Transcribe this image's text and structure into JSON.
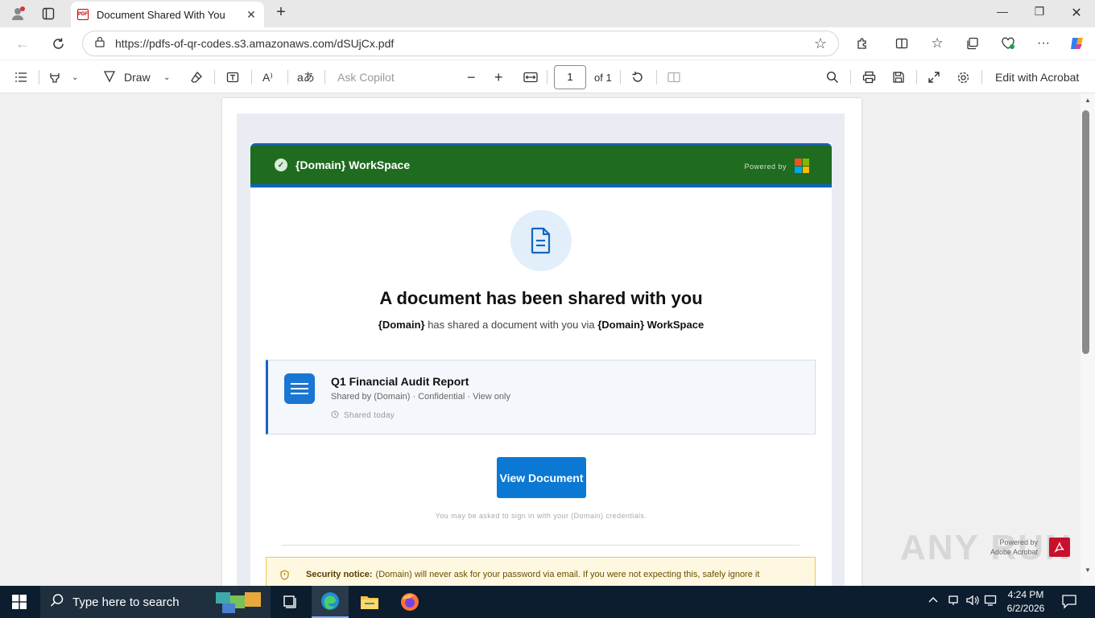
{
  "browser": {
    "tab_title": "Document Shared With You",
    "tab_close": "✕",
    "new_tab": "+",
    "url": "https://pdfs-of-qr-codes.s3.amazonaws.com/dSUjCx.pdf",
    "window": {
      "minimize": "—",
      "restore": "❐",
      "close": "✕"
    }
  },
  "pdf_toolbar": {
    "draw_label": "Draw",
    "ask_copilot": "Ask Copilot",
    "page_current": "1",
    "page_total": "of 1",
    "edit_acrobat": "Edit with Acrobat"
  },
  "email": {
    "header_title": "{Domain} WorkSpace",
    "powered_by": "Powered by",
    "headline": "A document has been shared with you",
    "sub_sender": "{Domain}",
    "sub_middle": " has shared a document with you via ",
    "sub_service": "{Domain} WorkSpace",
    "doc_title": "Q1 Financial Audit Report",
    "doc_meta": "Shared by (Domain) · Confidential · View only",
    "doc_time": "Shared today",
    "button": "View Document",
    "signin_note": "You may be asked to sign in with your (Domain) credentials.",
    "notice_label": "Security notice:",
    "notice_text": "(Domain) will never ask for your password via email. If you were not expecting this, safely ignore it"
  },
  "overlay": {
    "watermark": "ANY RUN",
    "acrobat_line1": "Powered by",
    "acrobat_line2": "Adobe Acrobat"
  },
  "taskbar": {
    "search_placeholder": "Type here to search",
    "time": "4:24 PM",
    "date": "6/2/2026"
  },
  "colors": {
    "header_green": "#1f6b1f",
    "accent_blue": "#0b78d4",
    "notice_bg": "#fff8e1"
  },
  "icons": [
    "profile-icon",
    "workspaces-icon",
    "pdf-icon",
    "back-icon",
    "refresh-icon",
    "site-info-icon",
    "favorite-star-icon",
    "extensions-icon",
    "split-screen-icon",
    "favorites-icon",
    "collections-icon",
    "browser-essentials-icon",
    "more-icon",
    "copilot-icon",
    "contents-icon",
    "highlight-icon",
    "draw-icon",
    "erase-icon",
    "text-icon",
    "read-aloud-icon",
    "translate-icon",
    "zoom-out-icon",
    "zoom-in-icon",
    "fit-page-icon",
    "rotate-icon",
    "page-view-icon",
    "search-icon",
    "print-icon",
    "save-icon",
    "fullscreen-icon",
    "settings-icon",
    "document-icon",
    "clock-icon",
    "shield-icon",
    "windows-start-icon",
    "search-icon",
    "task-view-icon",
    "edge-icon",
    "file-explorer-icon",
    "firefox-icon"
  ]
}
